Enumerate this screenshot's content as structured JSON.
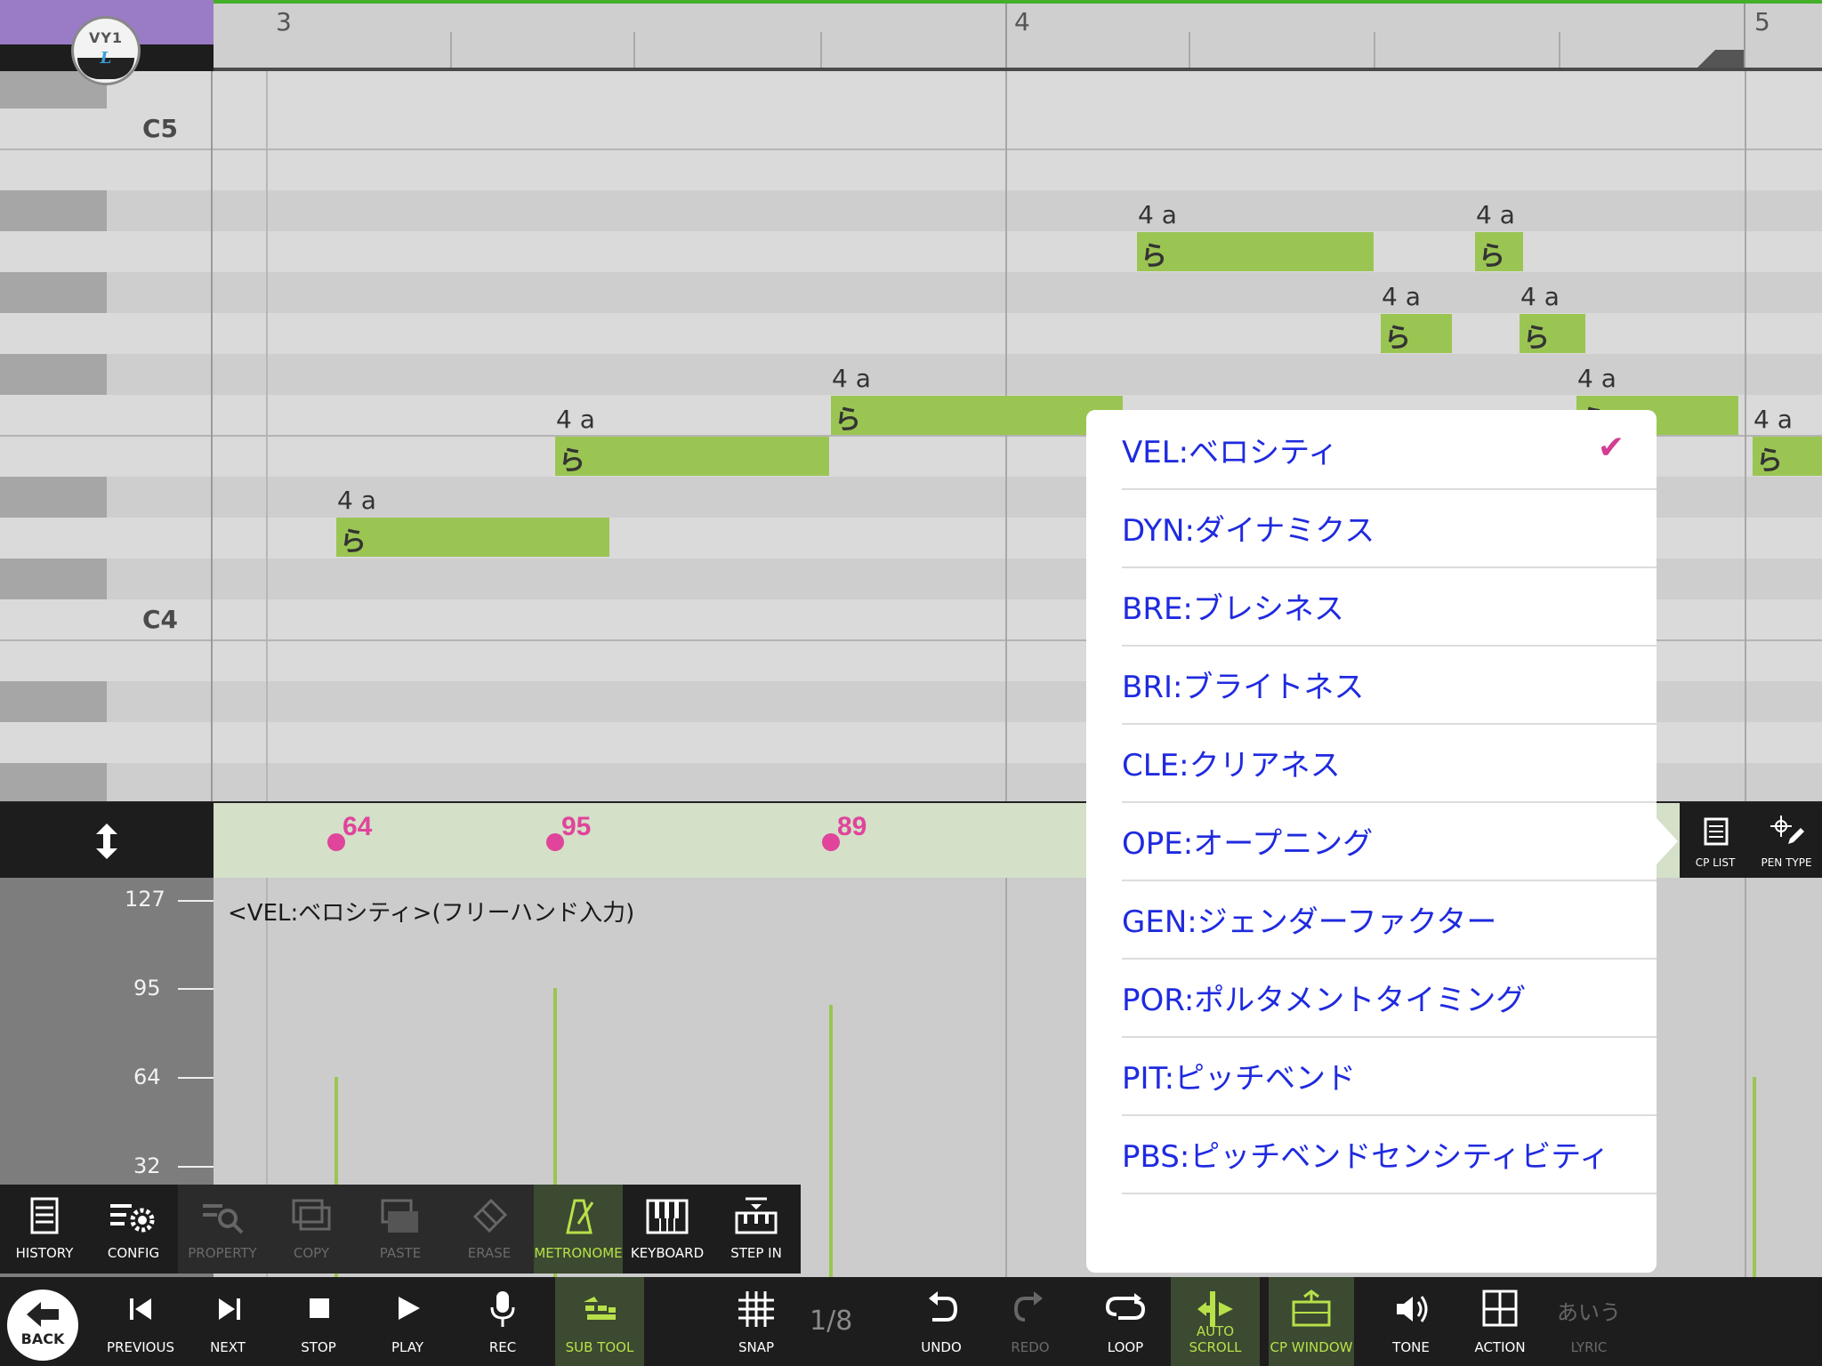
{
  "app": {
    "logo_text": "VY1",
    "logo_sub": "L"
  },
  "ruler": {
    "bars": [
      "3",
      "4",
      "5"
    ]
  },
  "piano": {
    "labels": [
      "C5",
      "C4"
    ]
  },
  "notes": [
    {
      "phoneme": "4 a",
      "lyric": "ら"
    },
    {
      "phoneme": "4 a",
      "lyric": "ら"
    },
    {
      "phoneme": "4 a",
      "lyric": "ら"
    },
    {
      "phoneme": "4 a",
      "lyric": "ら"
    },
    {
      "phoneme": "4 a",
      "lyric": "ら"
    },
    {
      "phoneme": "4 a",
      "lyric": "ら"
    },
    {
      "phoneme": "4 a",
      "lyric": "ら"
    },
    {
      "phoneme": "4 a",
      "lyric": "ら"
    },
    {
      "phoneme": "4 a",
      "lyric": "ら"
    }
  ],
  "control_strip": {
    "values": [
      "64",
      "95",
      "89"
    ]
  },
  "cp_graph": {
    "title": "<VEL:ベロシティ>(フリーハンド入力)",
    "y_labels": [
      "127",
      "95",
      "64",
      "32"
    ]
  },
  "right_tools": {
    "cp_list": "CP LIST",
    "pen_type": "PEN TYPE"
  },
  "menu": {
    "items": [
      {
        "label": "VEL:ベロシティ",
        "selected": true
      },
      {
        "label": "DYN:ダイナミクス"
      },
      {
        "label": "BRE:ブレシネス"
      },
      {
        "label": "BRI:ブライトネス"
      },
      {
        "label": "CLE:クリアネス"
      },
      {
        "label": "OPE:オープニング"
      },
      {
        "label": "GEN:ジェンダーファクター"
      },
      {
        "label": "POR:ポルタメントタイミング"
      },
      {
        "label": "PIT:ピッチベンド"
      },
      {
        "label": "PBS:ピッチベンドセンシティビティ"
      }
    ],
    "check_icon": "check-icon"
  },
  "subtools": [
    {
      "label": "HISTORY",
      "icon": "history-icon"
    },
    {
      "label": "CONFIG",
      "icon": "config-icon"
    },
    {
      "label": "PROPERTY",
      "icon": "property-icon"
    },
    {
      "label": "COPY",
      "icon": "copy-icon"
    },
    {
      "label": "PASTE",
      "icon": "paste-icon"
    },
    {
      "label": "ERASE",
      "icon": "erase-icon"
    },
    {
      "label": "METRONOME",
      "icon": "metronome-icon"
    },
    {
      "label": "KEYBOARD",
      "icon": "keyboard-icon"
    },
    {
      "label": "STEP IN",
      "icon": "step-in-icon"
    }
  ],
  "toolbar": {
    "back": "BACK",
    "previous": "PREVIOUS",
    "next": "NEXT",
    "stop": "STOP",
    "play": "PLAY",
    "rec": "REC",
    "sub_tool": "SUB TOOL",
    "snap": "SNAP",
    "snap_value": "1/8",
    "undo": "UNDO",
    "redo": "REDO",
    "loop": "LOOP",
    "auto_scroll": "AUTO SCROLL",
    "cp_window": "CP WINDOW",
    "tone": "TONE",
    "action": "ACTION",
    "lyric": "LYRIC",
    "lyric_icon_text": "あいう"
  },
  "colors": {
    "note": "#9bc553",
    "accent_green": "#b8e04a",
    "velocity": "#e0449b",
    "menu_text": "#1f2adf",
    "check": "#d43d95"
  }
}
